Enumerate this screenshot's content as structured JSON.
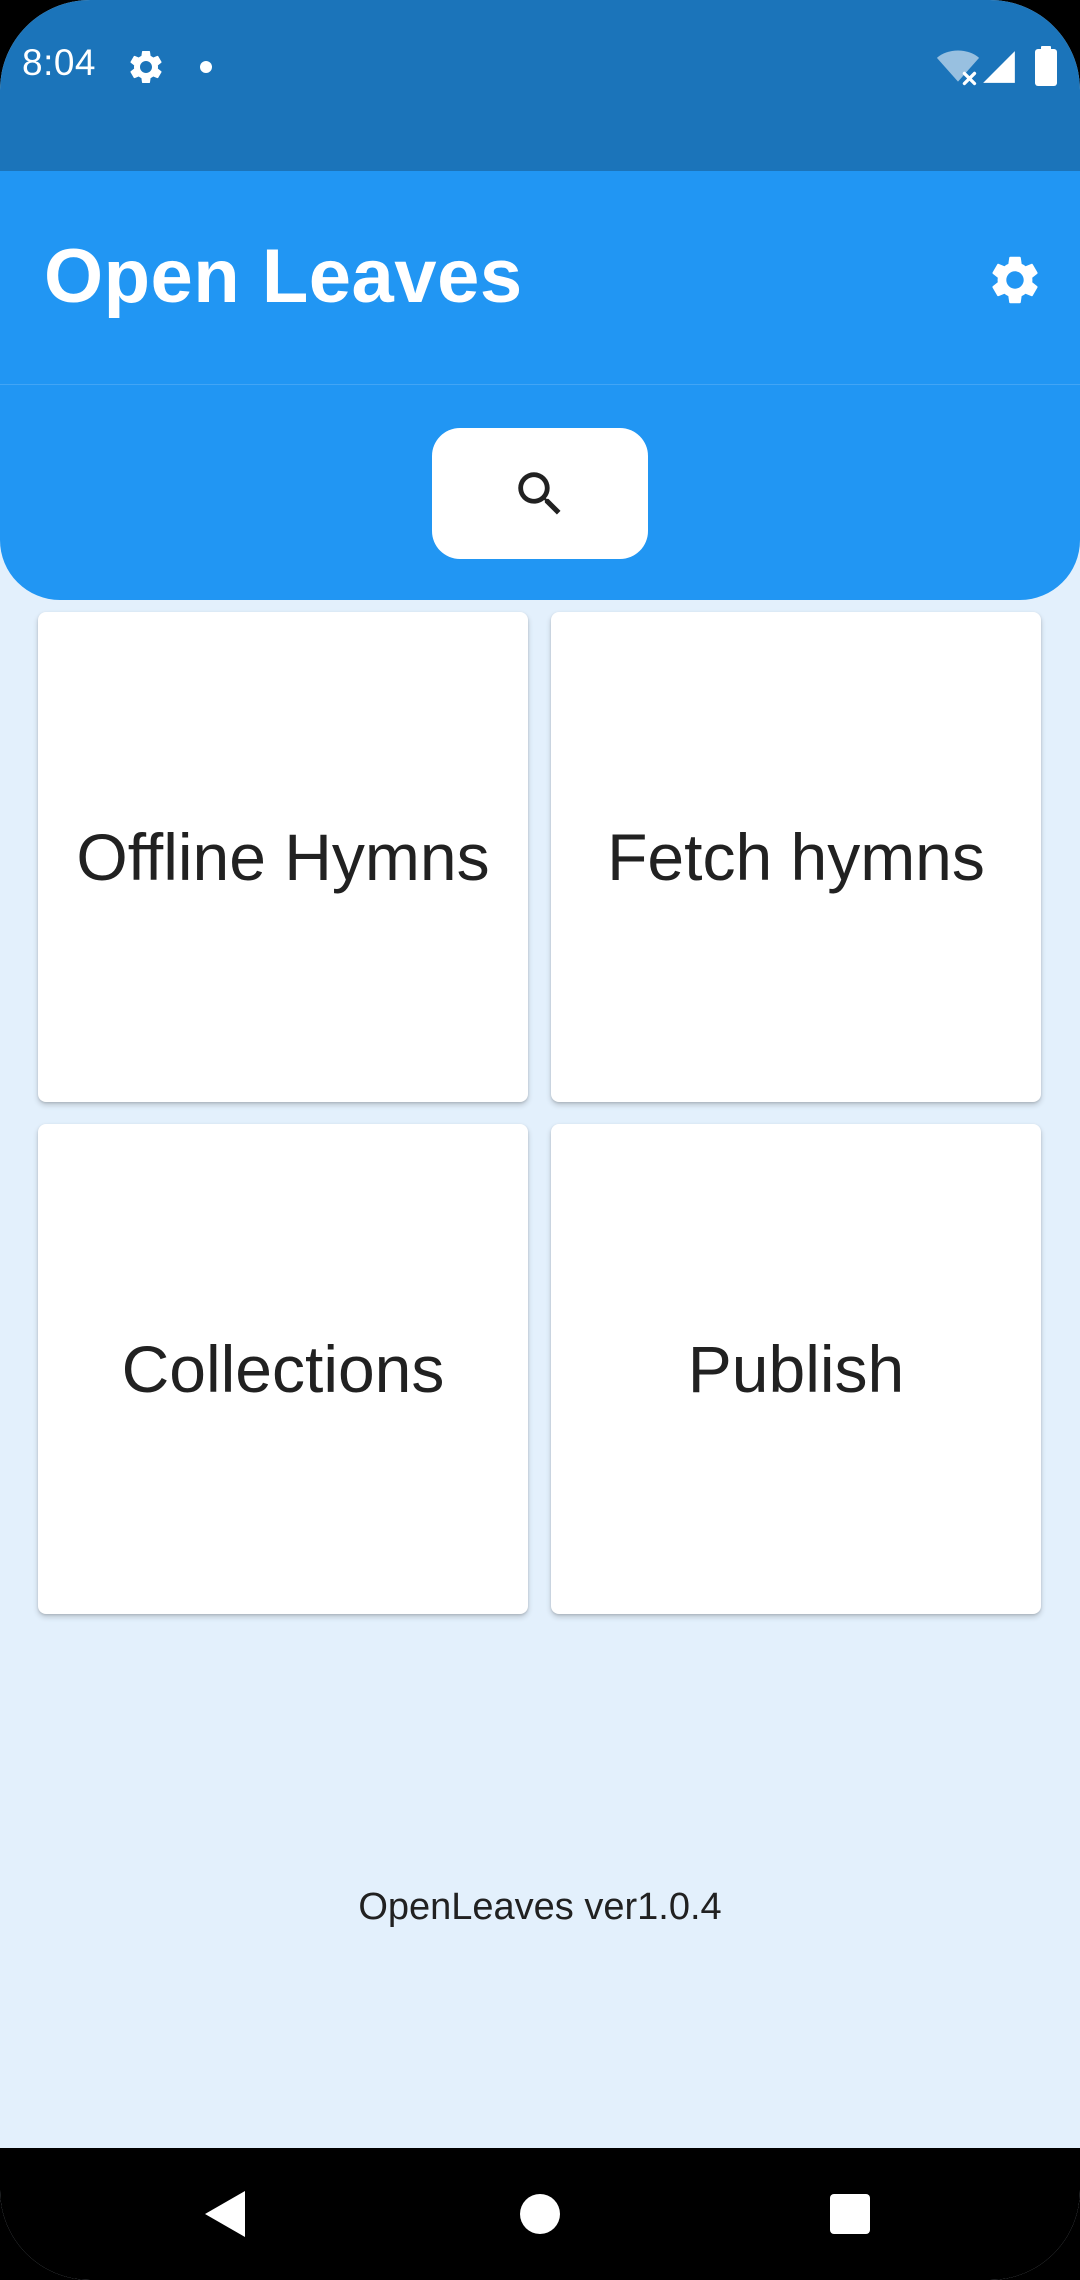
{
  "status_bar": {
    "time": "8:04",
    "icons": [
      "settings-icon",
      "notification-dot-icon",
      "wifi-off-icon",
      "signal-icon",
      "battery-icon"
    ]
  },
  "app_bar": {
    "title": "Open Leaves",
    "settings_icon": "gear-icon"
  },
  "search": {
    "icon": "search-icon"
  },
  "tiles": [
    {
      "label": "Offline Hymns"
    },
    {
      "label": "Fetch hymns"
    },
    {
      "label": "Collections"
    },
    {
      "label": "Publish"
    }
  ],
  "footer": {
    "version": "OpenLeaves ver1.0.4"
  },
  "navigation": {
    "buttons": [
      "back-icon",
      "home-icon",
      "recents-icon"
    ]
  },
  "colors": {
    "status_bar": "#1b74ba",
    "primary": "#2196f3",
    "background": "#e3f0fc",
    "tile": "#ffffff",
    "text": "#212121"
  }
}
